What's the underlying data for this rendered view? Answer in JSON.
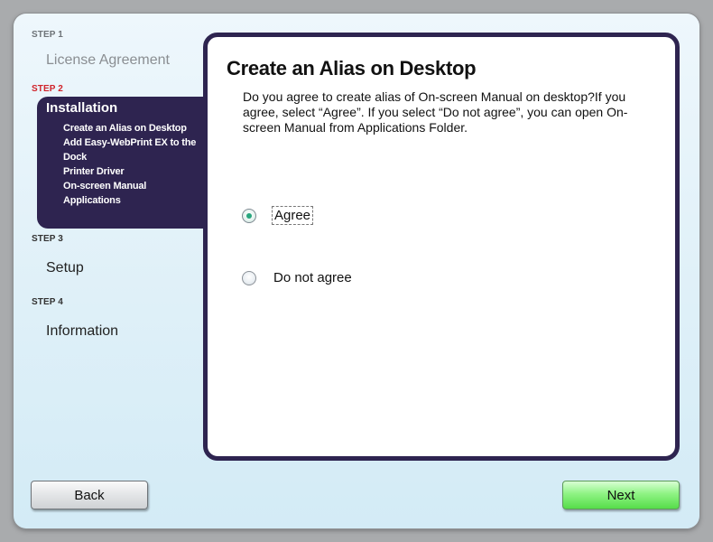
{
  "steps": [
    {
      "label": "STEP 1",
      "name": "License Agreement"
    },
    {
      "label": "STEP 2",
      "name": "Installation",
      "substeps": [
        "Create an Alias on Desktop",
        "Add Easy-WebPrint EX to the Dock",
        "Printer Driver",
        "On-screen Manual",
        "Applications"
      ]
    },
    {
      "label": "STEP 3",
      "name": "Setup"
    },
    {
      "label": "STEP 4",
      "name": "Information"
    }
  ],
  "panel": {
    "title": "Create an Alias on Desktop",
    "description": "Do you agree to create alias of On-screen Manual on desktop?If you agree, select “Agree”. If you select “Do not agree”, you can open On-screen Manual from Applications Folder."
  },
  "options": {
    "agree": "Agree",
    "disagree": "Do not agree"
  },
  "buttons": {
    "back": "Back",
    "next": "Next"
  },
  "colors": {
    "accent": "#2e2450",
    "active_step_label": "#d0232a",
    "next_button": "#8ff384",
    "radio_selected": "#28a67e"
  }
}
